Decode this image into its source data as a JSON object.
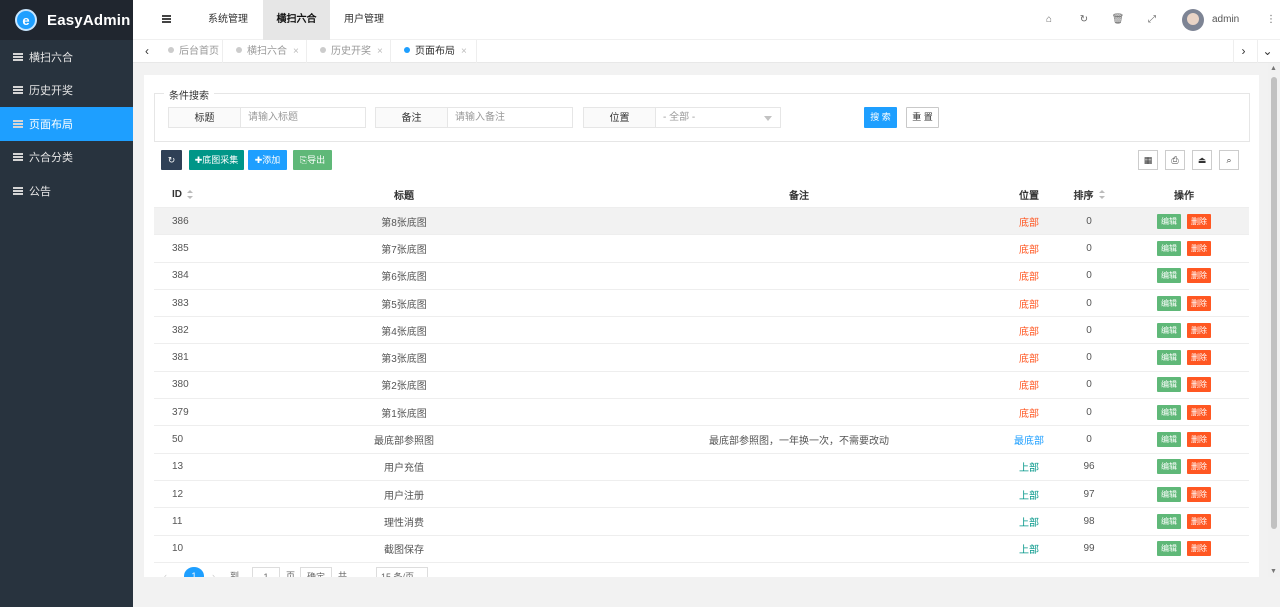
{
  "app": {
    "name": "EasyAdmin",
    "logo_letter": "e"
  },
  "sidebar": {
    "items": [
      {
        "label": "横扫六合"
      },
      {
        "label": "历史开奖"
      },
      {
        "label": "页面布局"
      },
      {
        "label": "六合分类"
      },
      {
        "label": "公告"
      }
    ]
  },
  "header": {
    "nav": [
      {
        "label": "系统管理"
      },
      {
        "label": "横扫六合"
      },
      {
        "label": "用户管理"
      }
    ],
    "username": "admin"
  },
  "tabs": [
    {
      "label": "后台首页"
    },
    {
      "label": "横扫六合"
    },
    {
      "label": "历史开奖"
    },
    {
      "label": "页面布局"
    }
  ],
  "search": {
    "legend": "条件搜索",
    "fields": [
      {
        "label": "标题",
        "placeholder": "请输入标题"
      },
      {
        "label": "备注",
        "placeholder": "请输入备注"
      },
      {
        "label": "位置",
        "selected": "- 全部 -"
      }
    ],
    "search_label": "搜 索",
    "reset_label": "重 置"
  },
  "toolbar": {
    "collect_label": "底图采集",
    "add_label": "添加",
    "export_label": "导出"
  },
  "table": {
    "columns": [
      "ID",
      "标题",
      "备注",
      "位置",
      "排序",
      "操作"
    ],
    "edit_label": "编辑",
    "delete_label": "删除",
    "rows": [
      {
        "id": "386",
        "title": "第8张底图",
        "note": "",
        "pos": "底部",
        "sort": "0"
      },
      {
        "id": "385",
        "title": "第7张底图",
        "note": "",
        "pos": "底部",
        "sort": "0"
      },
      {
        "id": "384",
        "title": "第6张底图",
        "note": "",
        "pos": "底部",
        "sort": "0"
      },
      {
        "id": "383",
        "title": "第5张底图",
        "note": "",
        "pos": "底部",
        "sort": "0"
      },
      {
        "id": "382",
        "title": "第4张底图",
        "note": "",
        "pos": "底部",
        "sort": "0"
      },
      {
        "id": "381",
        "title": "第3张底图",
        "note": "",
        "pos": "底部",
        "sort": "0"
      },
      {
        "id": "380",
        "title": "第2张底图",
        "note": "",
        "pos": "底部",
        "sort": "0"
      },
      {
        "id": "379",
        "title": "第1张底图",
        "note": "",
        "pos": "底部",
        "sort": "0"
      },
      {
        "id": "50",
        "title": "最底部参照图",
        "note": "最底部参照图，一年换一次，不需要改动",
        "pos": "最底部",
        "sort": "0"
      },
      {
        "id": "13",
        "title": "用户充值",
        "note": "",
        "pos": "上部",
        "sort": "96"
      },
      {
        "id": "12",
        "title": "用户注册",
        "note": "",
        "pos": "上部",
        "sort": "97"
      },
      {
        "id": "11",
        "title": "理性消费",
        "note": "",
        "pos": "上部",
        "sort": "98"
      },
      {
        "id": "10",
        "title": "截图保存",
        "note": "",
        "pos": "上部",
        "sort": "99"
      }
    ]
  },
  "pos_colors": {
    "底部": "#ff5722",
    "最底部": "#1e9fff",
    "上部": "#009688"
  },
  "pager": {
    "current": "1",
    "goto_prefix": "到第",
    "goto_value": "1",
    "goto_suffix": "页",
    "confirm": "确定",
    "total": "共 13 条",
    "per_page": "15 条/页"
  }
}
